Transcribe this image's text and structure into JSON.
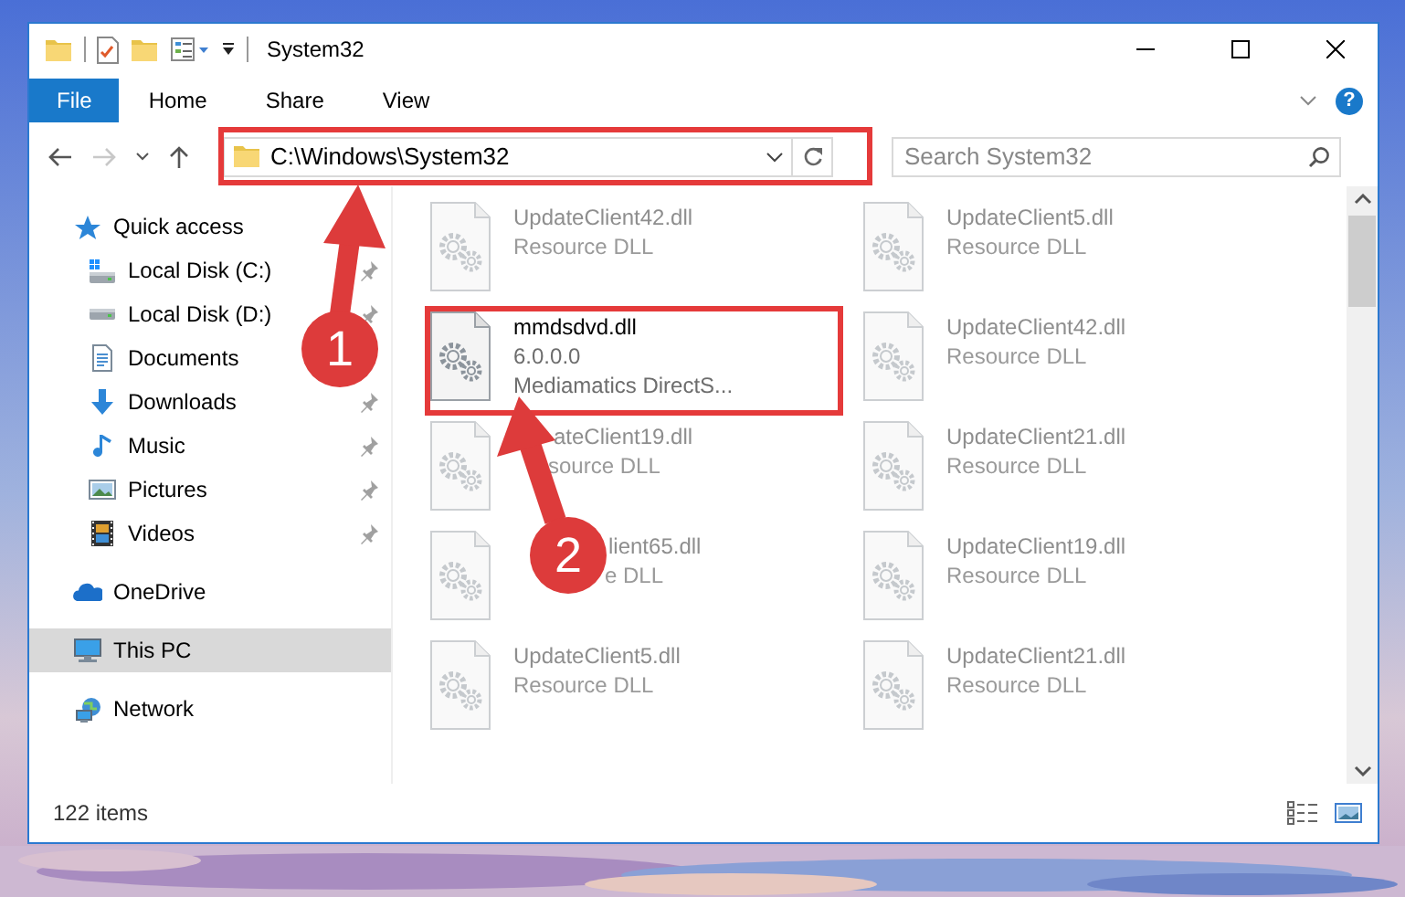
{
  "window": {
    "title": "System32",
    "help": "?"
  },
  "ribbon_tabs": [
    {
      "label": "File",
      "kind": "file",
      "selected": false
    },
    {
      "label": "Home",
      "kind": "tab",
      "selected": false
    },
    {
      "label": "Share",
      "kind": "tab",
      "selected": false
    },
    {
      "label": "View",
      "kind": "tab",
      "selected": false
    }
  ],
  "navigation": {
    "forward_disabled": true
  },
  "address": {
    "path": "C:\\Windows\\System32"
  },
  "search": {
    "placeholder": "Search System32"
  },
  "sidebar": {
    "items": [
      {
        "label": "Quick access",
        "kind": "star",
        "selected": false,
        "children": [
          {
            "label": "Local Disk (C:)",
            "kind": "system-drive",
            "selected": false,
            "pinned": true
          },
          {
            "label": "Local Disk (D:)",
            "kind": "drive",
            "selected": false,
            "pinned": true
          },
          {
            "label": "Documents",
            "kind": "documents",
            "selected": false,
            "pinned": false
          },
          {
            "label": "Downloads",
            "kind": "downloads",
            "selected": false,
            "pinned": true
          },
          {
            "label": "Music",
            "kind": "music",
            "selected": false,
            "pinned": true
          },
          {
            "label": "Pictures",
            "kind": "pictures",
            "selected": false,
            "pinned": true
          },
          {
            "label": "Videos",
            "kind": "videos",
            "selected": false,
            "pinned": true
          }
        ]
      },
      {
        "label": "OneDrive",
        "kind": "cloud",
        "selected": false
      },
      {
        "label": "This PC",
        "kind": "computer",
        "selected": true
      },
      {
        "label": "Network",
        "kind": "network",
        "selected": false
      }
    ]
  },
  "files": [
    {
      "name": "UpdateClient42.dll",
      "details": [
        "Resource DLL"
      ],
      "faded": true,
      "partly_covered": false
    },
    {
      "name": "UpdateClient5.dll",
      "details": [
        "Resource DLL"
      ],
      "faded": true,
      "partly_covered": false
    },
    {
      "name": "mmdsdvd.dll",
      "details": [
        "6.0.0.0",
        "Mediamatics DirectS..."
      ],
      "faded": false,
      "partly_covered": false
    },
    {
      "name": "UpdateClient42.dll",
      "details": [
        "Resource DLL"
      ],
      "faded": true,
      "partly_covered": false
    },
    {
      "name": "ateClient19.dll",
      "details": [
        "source DLL"
      ],
      "faded": true,
      "partly_covered": true
    },
    {
      "name": "UpdateClient21.dll",
      "details": [
        "Resource DLL"
      ],
      "faded": true,
      "partly_covered": false
    },
    {
      "name": "lient65.dll",
      "details": [
        "e DLL"
      ],
      "faded": true,
      "partly_covered": true
    },
    {
      "name": "UpdateClient19.dll",
      "details": [
        "Resource DLL"
      ],
      "faded": true,
      "partly_covered": false
    },
    {
      "name": "UpdateClient5.dll",
      "details": [
        "Resource DLL"
      ],
      "faded": true,
      "partly_covered": false
    },
    {
      "name": "UpdateClient21.dll",
      "details": [
        "Resource DLL"
      ],
      "faded": true,
      "partly_covered": false
    }
  ],
  "status_bar": {
    "item_count": "122 items"
  },
  "annotations": [
    {
      "number": "1"
    },
    {
      "number": "2"
    }
  ]
}
